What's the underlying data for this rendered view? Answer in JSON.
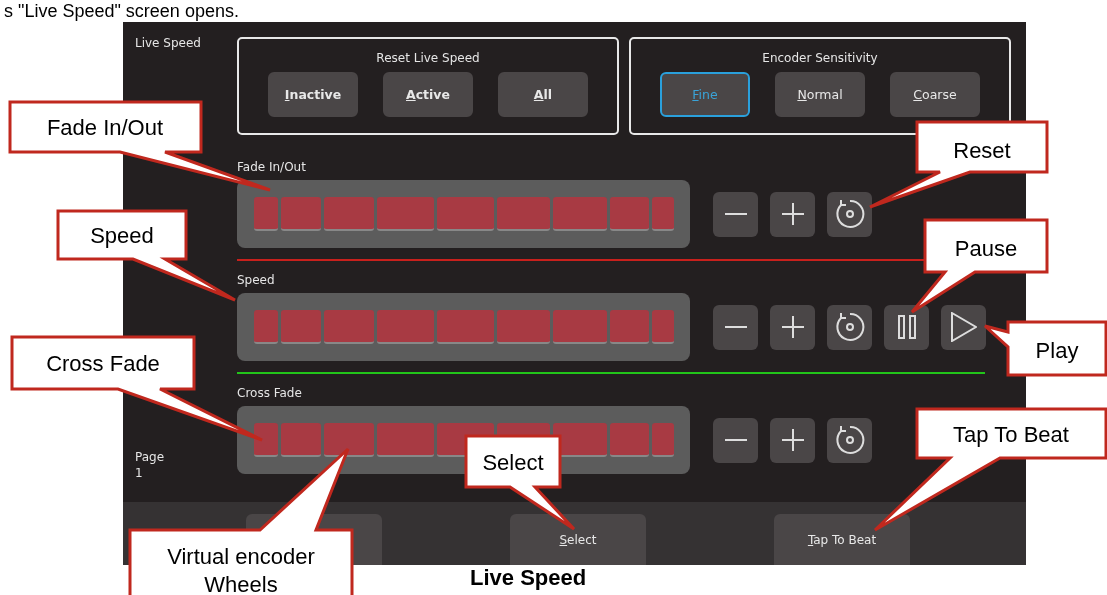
{
  "document": {
    "intro": "s \"Live Speed\" screen opens.",
    "caption": "Live Speed"
  },
  "screen": {
    "title": "Live Speed",
    "page_label": "Page",
    "page_number": "1",
    "reset_group": {
      "title": "Reset Live Speed",
      "buttons": [
        "Inactive",
        "Active",
        "All"
      ]
    },
    "sensitivity": {
      "title": "Encoder Sensitivity",
      "options": [
        {
          "label": "Fine",
          "selected": true
        },
        {
          "label": "Normal",
          "selected": false
        },
        {
          "label": "Coarse",
          "selected": false
        }
      ]
    },
    "encoders": [
      {
        "label": "Fade In/Out",
        "controls": [
          {
            "kind": "minus"
          },
          {
            "kind": "plus"
          },
          {
            "kind": "reset"
          }
        ],
        "color": "#c8201c"
      },
      {
        "label": "Speed",
        "controls": [
          {
            "kind": "minus"
          },
          {
            "kind": "plus"
          },
          {
            "kind": "reset"
          },
          {
            "kind": "pause"
          },
          {
            "kind": "play"
          }
        ],
        "color": "#22c41a"
      },
      {
        "label": "Cross Fade",
        "controls": [
          {
            "kind": "minus"
          },
          {
            "kind": "plus"
          },
          {
            "kind": "reset"
          }
        ]
      }
    ],
    "softkeys": [
      {
        "kind": "blank"
      },
      {
        "kind": "text",
        "label": "Select"
      },
      {
        "kind": "text",
        "label": "Tap To Beat"
      }
    ]
  },
  "callouts": [
    {
      "label": "Fade In/Out"
    },
    {
      "label": "Reset"
    },
    {
      "label": "Speed"
    },
    {
      "label": "Pause"
    },
    {
      "label": "Play"
    },
    {
      "label": "Cross Fade"
    },
    {
      "label": "Tap To Beat"
    },
    {
      "label": "Select"
    },
    {
      "label": "Virtual encoder Wheels"
    }
  ]
}
